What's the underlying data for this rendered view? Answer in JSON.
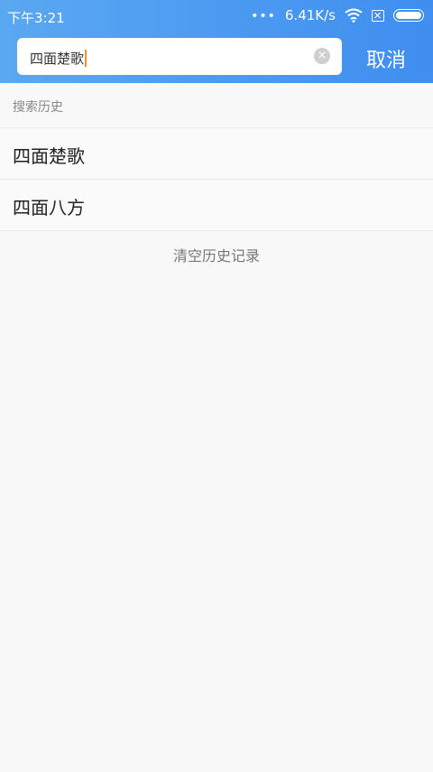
{
  "status_bar": {
    "time": "下午3:21",
    "dots": "•••",
    "speed": "6.41K/s"
  },
  "search": {
    "value": "四面楚歌",
    "clear_icon": "×"
  },
  "header": {
    "cancel_label": "取消"
  },
  "history": {
    "title": "搜索历史",
    "items": [
      "四面楚歌",
      "四面八方"
    ],
    "clear_label": "清空历史记录"
  },
  "colors": {
    "header_start": "#5aa8f2",
    "header_end": "#3f8ef0",
    "caret": "#ff8a1f"
  }
}
